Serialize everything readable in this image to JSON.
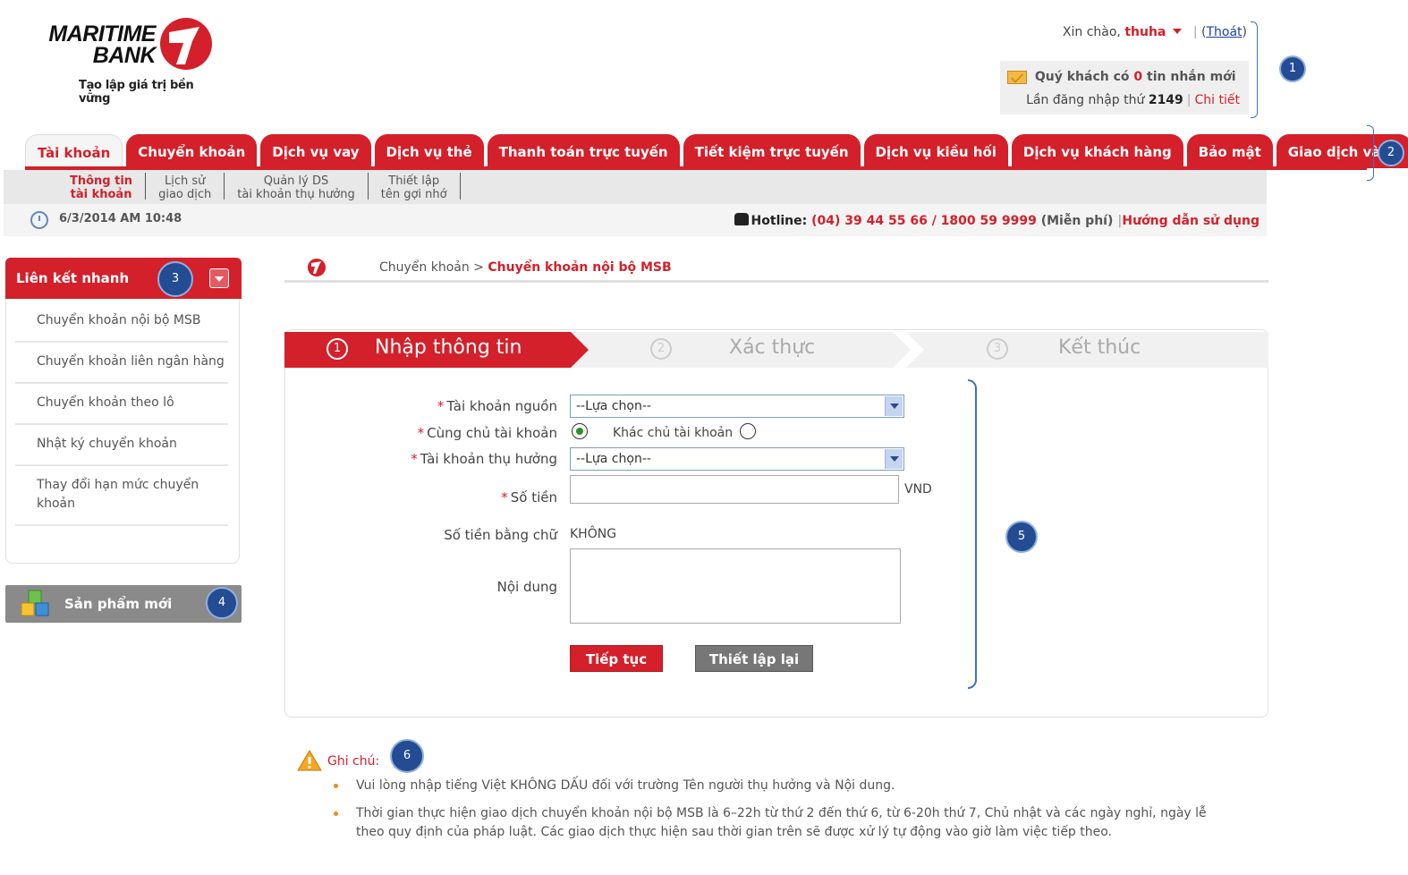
{
  "brand": {
    "name_line1": "MARITIME",
    "name_line2": "BANK",
    "slogan": "Tạo lập giá trị bền vững",
    "accent": "#d3202a"
  },
  "header": {
    "greeting": "Xin chào,",
    "username": "thuha",
    "logout": "Thoát",
    "messages_prefix": "Quý khách có",
    "messages_count": "0",
    "messages_suffix": "tin nhắn mới",
    "login_prefix": "Lần đăng nhập thứ",
    "login_count": "2149",
    "details_link": "Chi tiết"
  },
  "annotations": [
    "1",
    "2",
    "3",
    "4",
    "5",
    "6"
  ],
  "nav": {
    "tabs": [
      {
        "label": "Tài khoản",
        "active": true
      },
      {
        "label": "Chuyển khoản"
      },
      {
        "label": "Dịch vụ vay"
      },
      {
        "label": "Dịch vụ thẻ"
      },
      {
        "label": "Thanh toán trực tuyến"
      },
      {
        "label": "Tiết kiệm trực tuyến"
      },
      {
        "label": "Dịch vụ kiều hối"
      },
      {
        "label": "Dịch vụ khách hàng"
      },
      {
        "label": "Bảo mật"
      },
      {
        "label": "Giao dịch vàng"
      }
    ],
    "subtabs": [
      {
        "line1": "Thông tin",
        "line2": "tài khoản",
        "active": true
      },
      {
        "line1": "Lịch sử",
        "line2": "giao dịch"
      },
      {
        "line1": "Quản lý DS",
        "line2": "tài khoản thụ hưởng"
      },
      {
        "line1": "Thiết lập",
        "line2": "tên gợi nhớ"
      }
    ]
  },
  "status": {
    "datetime": "6/3/2014 AM 10:48",
    "hotline_label": "Hotline:",
    "hotline_numbers": "(04) 39 44 55 66 / 1800 59 9999",
    "hotline_free": "(Miễn phí)",
    "guide_link": "Hướng dẫn sử dụng"
  },
  "sidebar": {
    "quick_title": "Liên kết nhanh",
    "quick_items": [
      "Chuyển khoản nội bộ MSB",
      "Chuyển khoản liên ngân hàng",
      "Chuyển khoản theo lô",
      "Nhật ký chuyển khoản",
      "Thay đổi hạn mức chuyển khoản"
    ],
    "new_products": "Sản phẩm mới"
  },
  "breadcrumb": {
    "parent": "Chuyển khoản >",
    "current": "Chuyển khoản nội bộ MSB"
  },
  "steps": [
    {
      "num": "1",
      "label": "Nhập thông tin",
      "active": true
    },
    {
      "num": "2",
      "label": "Xác thực"
    },
    {
      "num": "3",
      "label": "Kết thúc"
    }
  ],
  "form": {
    "source_account_label": "Tài khoản nguồn",
    "source_account_value": "--Lựa chọn--",
    "same_owner_label": "Cùng chủ tài khoản",
    "other_owner_label": "Khác chủ tài khoản",
    "beneficiary_label": "Tài khoản thụ hưởng",
    "beneficiary_value": "--Lựa chọn--",
    "amount_label": "Số tiền",
    "amount_value": "",
    "currency": "VND",
    "amount_words_label": "Số tiền bằng chữ",
    "amount_words_value": "KHÔNG",
    "content_label": "Nội dung",
    "content_value": "",
    "continue_button": "Tiếp tục",
    "reset_button": "Thiết lập lại",
    "required_mark": "*"
  },
  "notes": {
    "title": "Ghi chú:",
    "items": [
      "Vui lòng nhập tiếng Việt KHÔNG DẤU đối với trường Tên người thụ hưởng và Nội dung.",
      "Thời gian thực hiện giao dịch chuyển khoản nội bộ MSB là 6–22h từ thứ 2 đến thứ 6, từ 6-20h thứ 7, Chủ nhật và các ngày nghỉ, ngày lễ theo quy định của pháp luật. Các giao dịch thực hiện sau thời gian trên sẽ được xử lý tự động vào giờ làm việc tiếp theo."
    ]
  },
  "icons": [
    "bank-logo-icon",
    "envelope-icon",
    "clock-icon",
    "phone-icon",
    "dropdown-arrow-icon",
    "cubes-icon",
    "breadcrumb-logo-icon",
    "warning-icon"
  ]
}
